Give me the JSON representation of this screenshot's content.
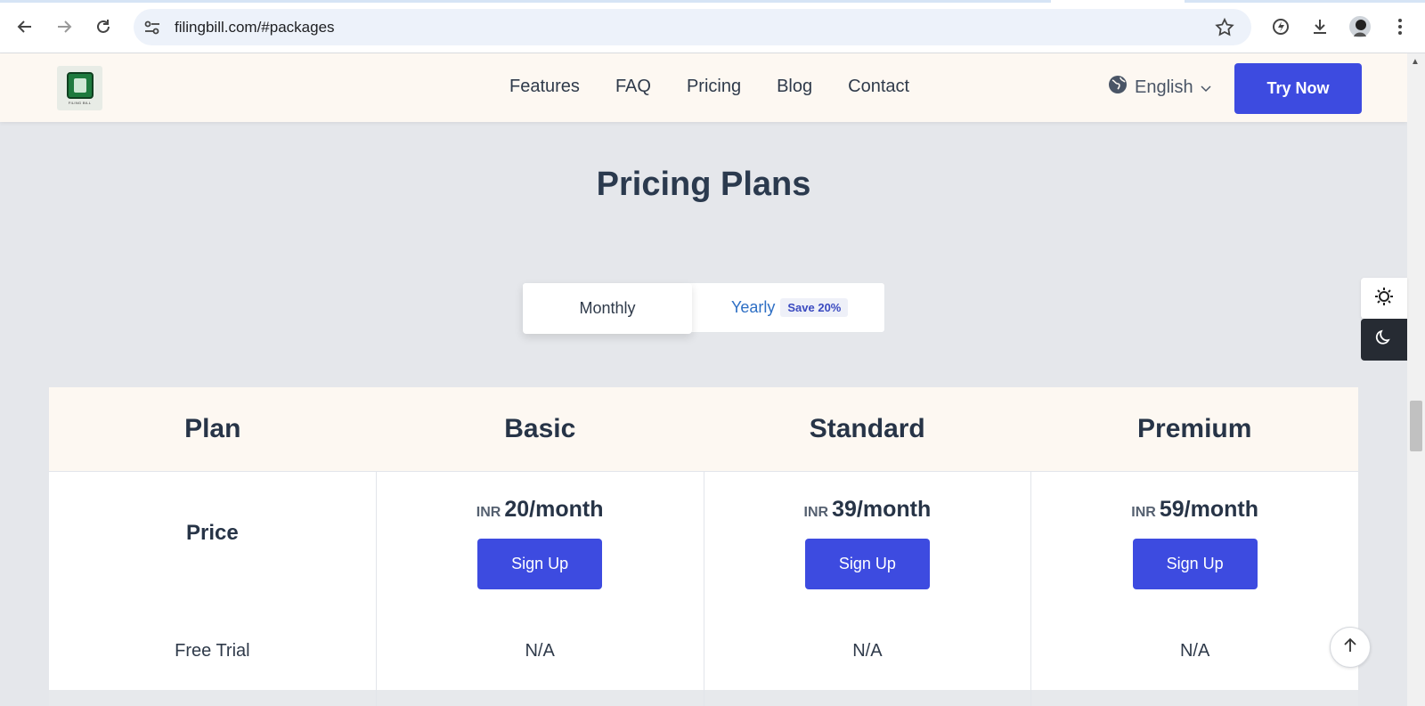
{
  "browser": {
    "url": "filingbill.com/#packages"
  },
  "header": {
    "logo_text": "FILING BILL",
    "nav": [
      "Features",
      "FAQ",
      "Pricing",
      "Blog",
      "Contact"
    ],
    "language": "English",
    "cta": "Try Now"
  },
  "main": {
    "title": "Pricing Plans",
    "toggle": {
      "monthly": "Monthly",
      "yearly": "Yearly",
      "save_badge": "Save 20%"
    },
    "table": {
      "headers": [
        "Plan",
        "Basic",
        "Standard",
        "Premium"
      ],
      "price_label": "Price",
      "currency": "INR",
      "prices": [
        "20/month",
        "39/month",
        "59/month"
      ],
      "signup_label": "Sign Up",
      "free_trial_label": "Free Trial",
      "free_trial_values": [
        "N/A",
        "N/A",
        "N/A"
      ]
    }
  },
  "colors": {
    "accent": "#3d4be0",
    "header_bg": "#fdf8f2",
    "page_bg": "#e5e7eb"
  },
  "icons": {
    "theme_light": "sun-icon",
    "theme_dark": "moon-icon",
    "back_to_top": "arrow-up-icon",
    "language": "globe-icon"
  }
}
